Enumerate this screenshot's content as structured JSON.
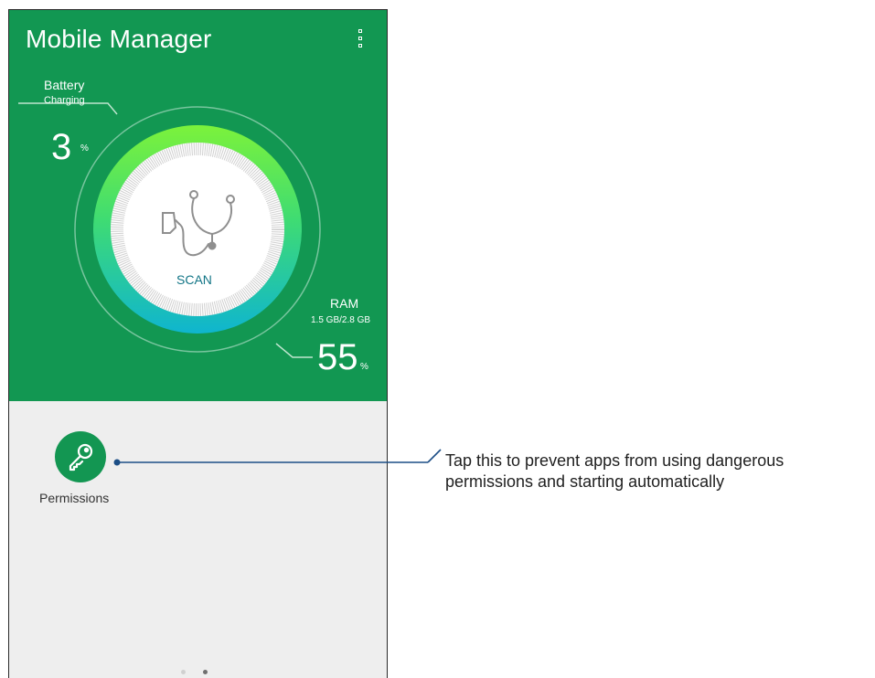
{
  "app": {
    "title": "Mobile Manager",
    "menu_icon": "more-vert-icon"
  },
  "battery": {
    "title": "Battery",
    "status": "Charging",
    "value": "3",
    "unit": "%"
  },
  "ram": {
    "title": "RAM",
    "usage": "1.5 GB/2.8 GB",
    "value": "55",
    "unit": "%"
  },
  "scan": {
    "label": "SCAN",
    "icon": "stethoscope-icon"
  },
  "permissions": {
    "label": "Permissions",
    "icon": "key-icon"
  },
  "pager": {
    "pages": 2,
    "active": 1
  },
  "callout": {
    "line1": "Tap this to prevent apps from using dangerous",
    "line2": "permissions and starting automatically"
  },
  "colors": {
    "primary_green": "#129752",
    "ring_top": "#6ef23c",
    "ring_bottom": "#10b9c9",
    "scan_text": "#127586",
    "callout_line": "#1c4e86",
    "bottom_bg": "#eeeeee"
  }
}
